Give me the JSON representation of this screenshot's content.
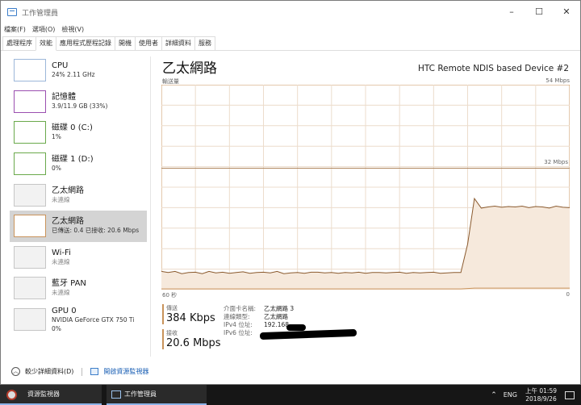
{
  "window": {
    "title": "工作管理員",
    "controls": [
      "–",
      "☐",
      "✕"
    ]
  },
  "menu": [
    "檔案(F)",
    "選項(O)",
    "檢視(V)"
  ],
  "tabs": [
    "處理程序",
    "效能",
    "應用程式歷程記錄",
    "開機",
    "使用者",
    "詳細資料",
    "服務"
  ],
  "active_tab": "效能",
  "sidebar": {
    "items": [
      {
        "name": "CPU",
        "sub": "24%  2.11 GHz",
        "kind": "cpu",
        "dim": false
      },
      {
        "name": "記憶體",
        "sub": "3.9/11.9 GB (33%)",
        "kind": "mem",
        "dim": false
      },
      {
        "name": "磁碟 0 (C:)",
        "sub": "1%",
        "kind": "disk",
        "dim": false
      },
      {
        "name": "磁碟 1 (D:)",
        "sub": "0%",
        "kind": "disk",
        "dim": false
      },
      {
        "name": "乙太網路",
        "sub": "未連線",
        "kind": "grey",
        "dim": true
      },
      {
        "name": "乙太網路",
        "sub": "已傳送: 0.4  已接收: 20.6 Mbps",
        "kind": "net",
        "dim": false
      },
      {
        "name": "Wi-Fi",
        "sub": "未連線",
        "kind": "grey",
        "dim": true
      },
      {
        "name": "藍牙 PAN",
        "sub": "未連線",
        "kind": "grey",
        "dim": true
      },
      {
        "name": "GPU 0",
        "sub": "NVIDIA GeForce GTX 750 Ti\n0%",
        "kind": "grey",
        "dim": false
      }
    ],
    "active_index": 5
  },
  "main": {
    "title": "乙太網路",
    "device": "HTC Remote NDIS based Device #2",
    "axis_top_left": "輸送量",
    "axis_top_right": "54 Mbps",
    "mid_label": "32 Mbps",
    "axis_bottom_left": "60 秒",
    "axis_bottom_right": "0",
    "send_label": "傳送",
    "send_value": "384 Kbps",
    "recv_label": "接收",
    "recv_value": "20.6 Mbps",
    "info": [
      {
        "k": "介面卡名稱:",
        "v": "乙太網路 3"
      },
      {
        "k": "連線類型:",
        "v": "乙太網路"
      },
      {
        "k": "IPv4 位址:",
        "v": "192.168."
      },
      {
        "k": "IPv6 位址:",
        "v": ""
      }
    ]
  },
  "footer": {
    "fewer_details": "較少詳細資料(D)",
    "open_resmon": "開啟資源監視器"
  },
  "taskbar": {
    "items": [
      "資源監視器",
      "工作管理員"
    ],
    "lang": "ENG",
    "time": "上午 01:59",
    "date": "2018/9/26"
  },
  "chart_data": {
    "type": "area",
    "ylim": [
      0,
      54
    ],
    "scale_unit": "Mbps",
    "xlim": [
      60,
      0
    ],
    "x_unit": "秒",
    "series": [
      {
        "color": "#8a5a2e",
        "fill": "#f6e9dc",
        "values": [
          4.8,
          4.5,
          4.8,
          4.2,
          4.5,
          4.6,
          4.2,
          4.8,
          4.4,
          4.6,
          4.3,
          4.5,
          4.7,
          4.3,
          4.5,
          4.6,
          4.4,
          4.8,
          4.2,
          4.4,
          4.5,
          4.3,
          4.6,
          4.6,
          4.4,
          4.5,
          4.3,
          4.5,
          4.4,
          4.6,
          4.3,
          4.5,
          4.5,
          4.4,
          4.5,
          4.6,
          4.3,
          4.5,
          4.4,
          4.5,
          4.6,
          4.3,
          4.4,
          4.5,
          4.5,
          12.0,
          24.0,
          21.5,
          21.8,
          22.0,
          21.7,
          21.9,
          21.8,
          22.0,
          21.6,
          21.9,
          21.8,
          21.5,
          22.0,
          21.7,
          21.6
        ]
      },
      {
        "color": "#c9935b",
        "fill": "none",
        "values": [
          0.2,
          0.2,
          0.2,
          0.2,
          0.2,
          0.2,
          0.2,
          0.2,
          0.2,
          0.2,
          0.2,
          0.2,
          0.2,
          0.2,
          0.2,
          0.2,
          0.2,
          0.2,
          0.2,
          0.2,
          0.2,
          0.2,
          0.2,
          0.2,
          0.2,
          0.2,
          0.2,
          0.2,
          0.2,
          0.2,
          0.2,
          0.2,
          0.2,
          0.2,
          0.2,
          0.2,
          0.2,
          0.2,
          0.2,
          0.2,
          0.2,
          0.2,
          0.2,
          0.2,
          0.2,
          0.3,
          0.4,
          0.4,
          0.4,
          0.4,
          0.4,
          0.4,
          0.4,
          0.4,
          0.4,
          0.4,
          0.4,
          0.4,
          0.4,
          0.4,
          0.4
        ]
      }
    ]
  }
}
